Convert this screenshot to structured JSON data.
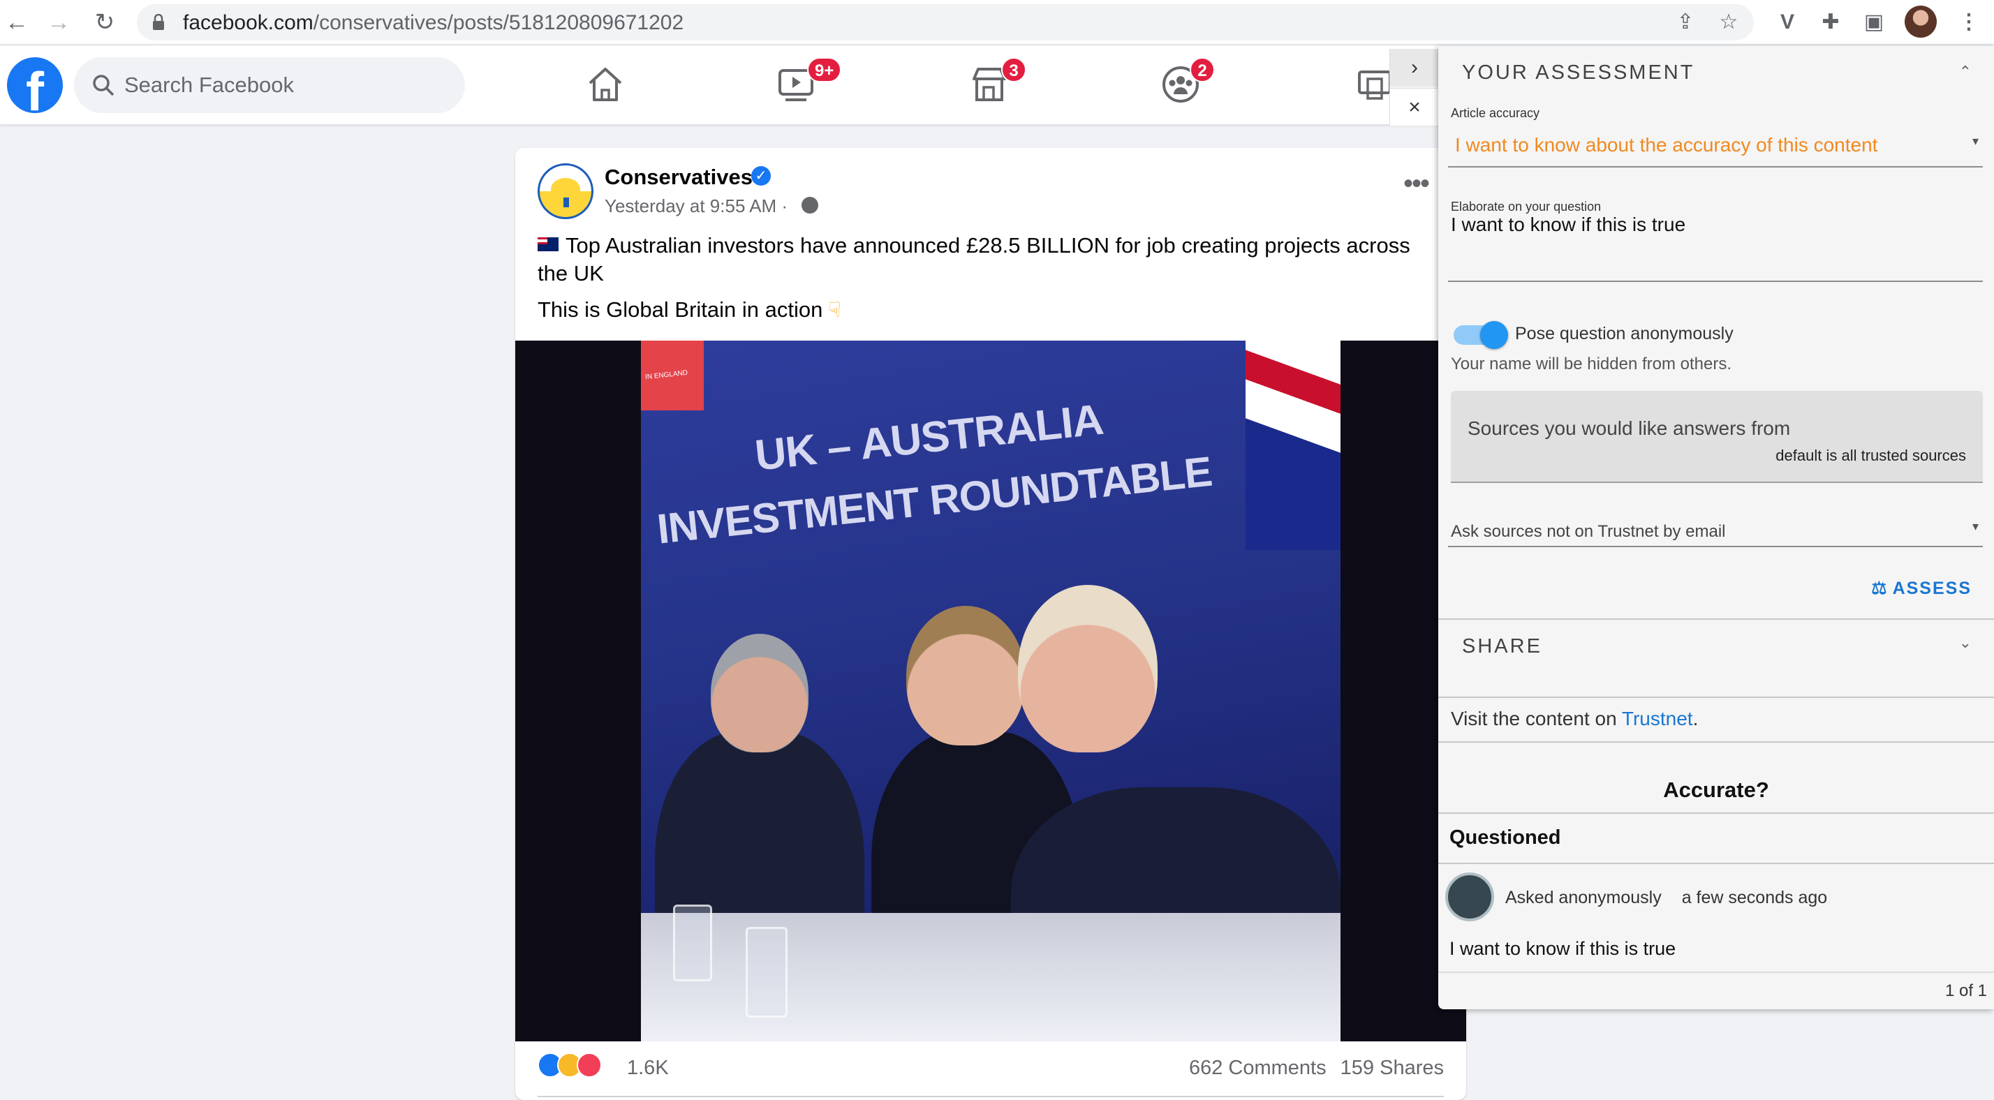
{
  "browser": {
    "url_host": "facebook.com",
    "url_path": "/conservatives/posts/518120809671202"
  },
  "facebook": {
    "search_placeholder": "Search Facebook",
    "nav": [
      {
        "name": "home",
        "badge": ""
      },
      {
        "name": "watch",
        "badge": "9+"
      },
      {
        "name": "marketplace",
        "badge": "3"
      },
      {
        "name": "groups",
        "badge": "2"
      },
      {
        "name": "gaming",
        "badge": ""
      }
    ]
  },
  "post": {
    "author": "Conservatives",
    "time": "Yesterday at 9:55 AM · ",
    "text_line1": "Top Australian investors have announced £28.5 BILLION for job creating projects across the UK",
    "text_line2": "This is Global Britain in action",
    "photo_text_1": "UK – AUSTRALIA",
    "photo_text_2": "INVESTMENT ROUNDTABLE",
    "photo_text_3": "IN ENGLAND",
    "reactions_count": "1.6K",
    "comments": "662 Comments",
    "shares": "159 Shares"
  },
  "ext_tab": {
    "expand": "›",
    "close": "×"
  },
  "panel": {
    "assessment_header": "YOUR ASSESSMENT",
    "article_accuracy_label": "Article accuracy",
    "article_accuracy_value": "I want to know about the accuracy of this content",
    "elaborate_label": "Elaborate on your question",
    "elaborate_value": "I want to know if this is true",
    "anon_label": "Pose question anonymously",
    "anon_helper": "Your name will be hidden from others.",
    "sources_label": "Sources you would like answers from",
    "sources_hint": "default is all trusted sources",
    "email_label": "Ask sources not on Trustnet by email",
    "assess_button": "ASSESS",
    "share_header": "SHARE",
    "visit_prefix": "Visit the content on ",
    "visit_link": "Trustnet",
    "visit_suffix": ".",
    "accurate_title": "Accurate?",
    "questioned_title": "Questioned",
    "question_author": "Asked anonymously",
    "question_time": "a few seconds ago",
    "question_text": "I want to know if this is true",
    "pager": "1 of 1"
  },
  "colors": {
    "fb_blue": "#1877f2",
    "accent_orange": "#f0891f",
    "link_blue": "#1976d2",
    "badge_red": "#e41e3f"
  }
}
